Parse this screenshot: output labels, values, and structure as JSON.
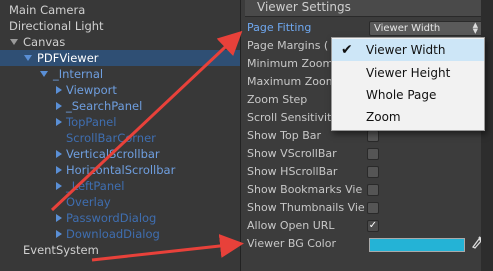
{
  "hierarchy": {
    "items": [
      {
        "label": "Main Camera"
      },
      {
        "label": "Directional Light"
      },
      {
        "label": "Canvas"
      },
      {
        "label": "PDFViewer"
      },
      {
        "label": "_Internal"
      },
      {
        "label": "Viewport"
      },
      {
        "label": "_SearchPanel"
      },
      {
        "label": "TopPanel"
      },
      {
        "label": "ScrollBarCorner"
      },
      {
        "label": "VerticalScrollbar"
      },
      {
        "label": "HorizontalScrollbar"
      },
      {
        "label": "_LeftPanel"
      },
      {
        "label": "Overlay"
      },
      {
        "label": "PasswordDialog"
      },
      {
        "label": "DownloadDialog"
      },
      {
        "label": "EventSystem"
      }
    ]
  },
  "inspector": {
    "title": "Viewer Settings",
    "properties": [
      {
        "label": "Page Fitting"
      },
      {
        "label": "Page Margins ("
      },
      {
        "label": "Minimum Zoom"
      },
      {
        "label": "Maximum Zoom"
      },
      {
        "label": "Zoom Step"
      },
      {
        "label": "Scroll Sensitivit"
      },
      {
        "label": "Show Top Bar"
      },
      {
        "label": "Show VScrollBar"
      },
      {
        "label": "Show HScrollBar"
      },
      {
        "label": "Show Bookmarks Vie"
      },
      {
        "label": "Show Thumbnails Vie"
      },
      {
        "label": "Allow Open URL"
      },
      {
        "label": "Viewer BG Color"
      }
    ],
    "page_fitting_value": "Viewer Width",
    "allow_open_url_checked": "✓",
    "bg_color": "#24b3d6"
  },
  "popup": {
    "options": [
      "Viewer Width",
      "Viewer Height",
      "Whole Page",
      "Zoom"
    ],
    "selected": "Viewer Width"
  },
  "icons": {
    "checkmark": "checkmark-icon",
    "eyedropper": "eyedropper-icon"
  },
  "annotation_color": "#e8413a"
}
